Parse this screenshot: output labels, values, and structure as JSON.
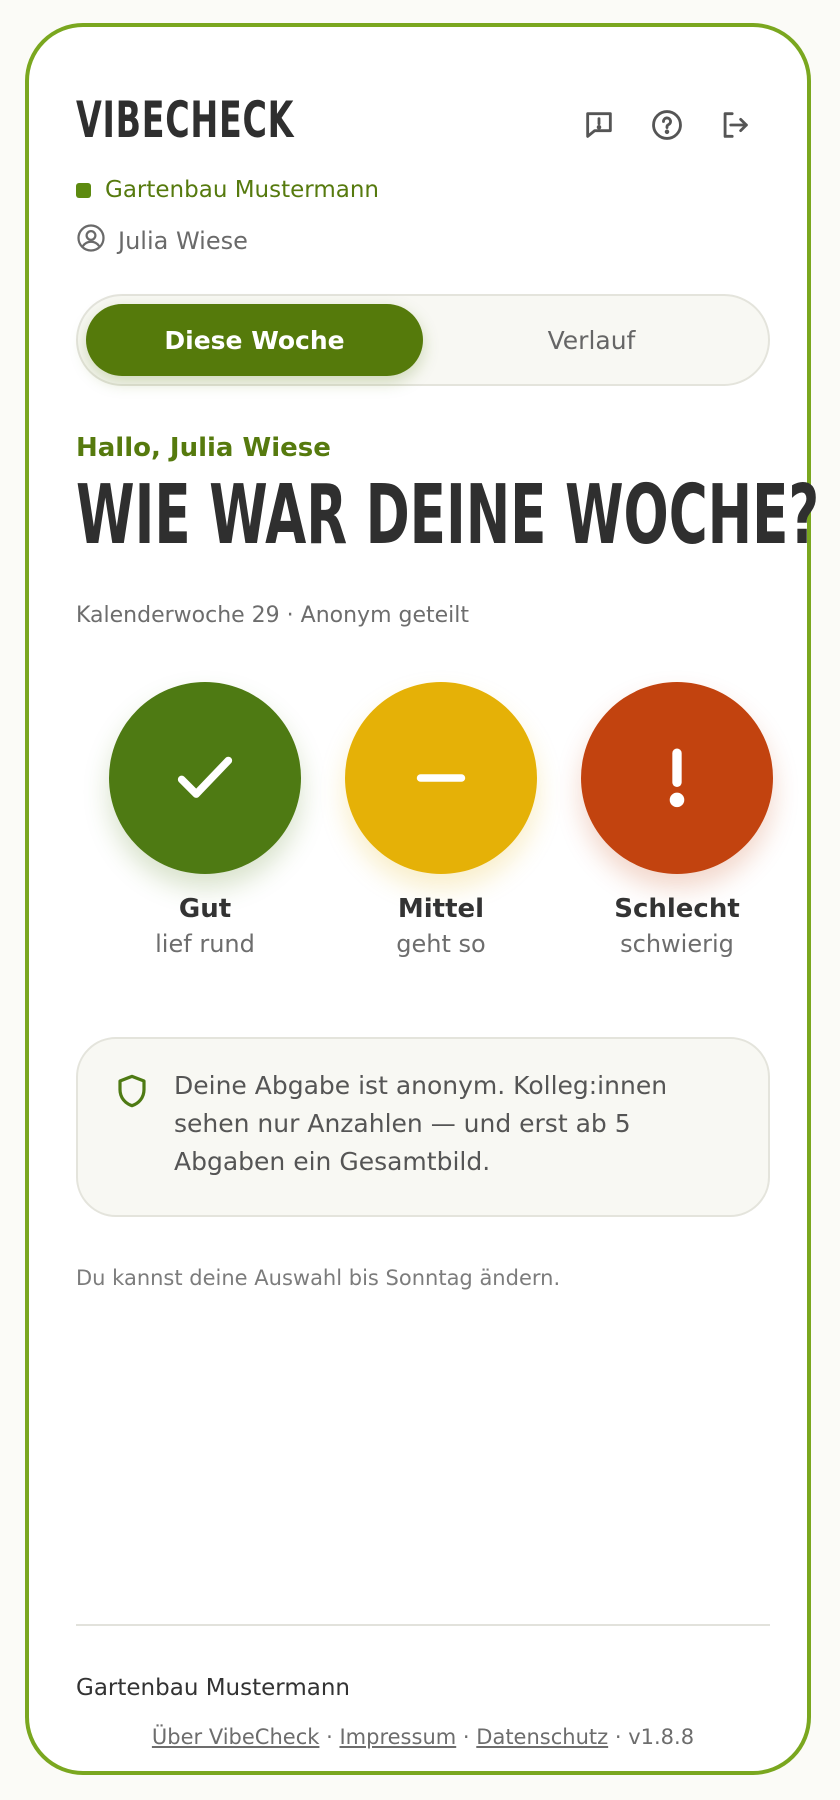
{
  "header": {
    "brand": "VIBECHECK",
    "icons": [
      "feedback-icon",
      "help-icon",
      "logout-icon"
    ],
    "company": "Gartenbau Mustermann",
    "user": "Julia Wiese"
  },
  "tabs": [
    {
      "label": "Diese Woche",
      "active": true
    },
    {
      "label": "Verlauf",
      "active": false
    }
  ],
  "main": {
    "greeting": "Hallo, Julia Wiese",
    "headline": "WIE WAR DEINE WOCHE?",
    "subline": "Kalenderwoche 29 · Anonym geteilt"
  },
  "options": [
    {
      "label": "Gut",
      "sub": "lief rund",
      "color": "#4e7a13",
      "icon": "check-icon"
    },
    {
      "label": "Mittel",
      "sub": "geht so",
      "color": "#e5b107",
      "icon": "minus-icon"
    },
    {
      "label": "Schlecht",
      "sub": "schwierig",
      "color": "#c2430f",
      "icon": "exclamation-icon"
    }
  ],
  "info": {
    "text": "Deine Abgabe ist anonym. Kolleg:innen sehen nur Anzahlen — und erst ab 5 Abgaben ein Gesamtbild.",
    "icon": "shield-icon"
  },
  "hint": "Du kannst deine Auswahl bis Sonntag ändern.",
  "footer": {
    "company": "Gartenbau Mustermann",
    "links": [
      "Über VibeCheck",
      "Impressum",
      "Datenschutz"
    ],
    "version": "v1.8.8",
    "separator": "·"
  },
  "colors": {
    "accent": "#557a0b",
    "border": "#7aa71f"
  }
}
